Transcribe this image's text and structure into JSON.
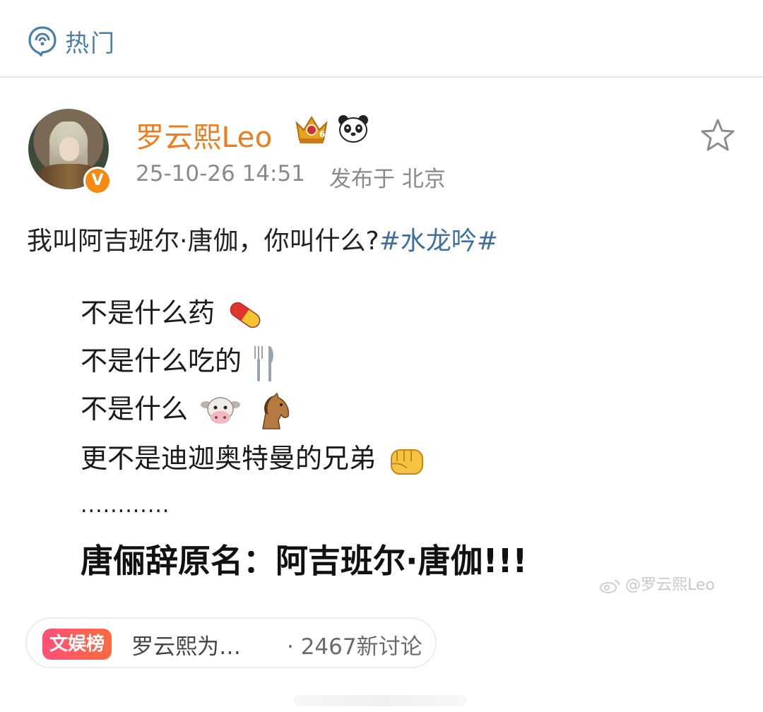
{
  "header": {
    "hot_label": "热门",
    "icon": "hot-icon"
  },
  "post": {
    "username": "罗云熙Leo",
    "timestamp": "25-10-26 14:51",
    "location": "发布于 北京",
    "verified_mark": "V",
    "text_main": "我叫阿吉班尔·唐伽，你叫什么?",
    "hashtag": "#水龙吟#",
    "lines": [
      {
        "text": "不是什么药",
        "emoji": "pill-emoji"
      },
      {
        "text": "不是什么吃的",
        "emoji": "fork-knife-emoji"
      },
      {
        "text": "不是什么",
        "emoji": "cow-horse-emoji"
      },
      {
        "text": "更不是迪迦奥特曼的兄弟",
        "emoji": "fist-emoji"
      }
    ],
    "dots": "............",
    "bold_line": "唐俪辞原名：阿吉班尔·唐伽!!!",
    "watermark": "@罗云熙Leo"
  },
  "trend": {
    "badge": "文娱榜",
    "text": "罗云熙为…",
    "count": "· 2467新讨论"
  },
  "colors": {
    "username": "#f07b18",
    "hashtag": "#3e6fa0",
    "header_label": "#4c7fa8",
    "meta": "#8a8a8a"
  }
}
